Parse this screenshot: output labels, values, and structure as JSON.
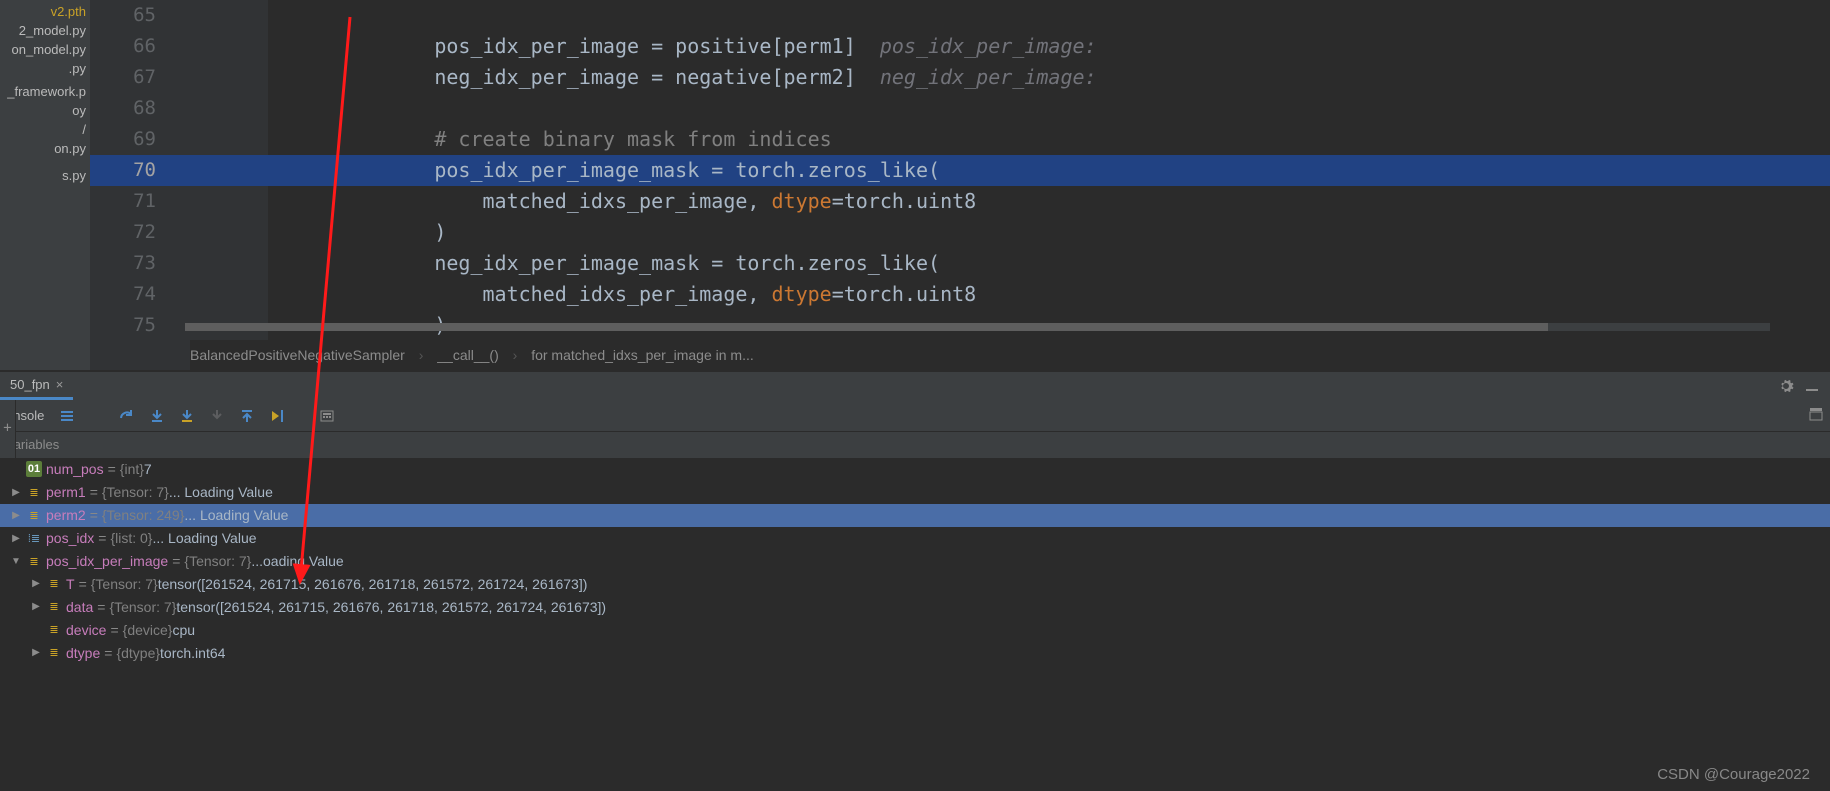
{
  "sidebar_files": [
    {
      "name": "v2.pth",
      "cls": "y"
    },
    {
      "name": "2_model.py",
      "cls": ""
    },
    {
      "name": "on_model.py",
      "cls": ""
    },
    {
      "name": ".py",
      "cls": ""
    },
    {
      "name": "",
      "cls": ""
    },
    {
      "name": "_framework.p",
      "cls": ""
    },
    {
      "name": "oy",
      "cls": ""
    },
    {
      "name": "/",
      "cls": ""
    },
    {
      "name": "on.py",
      "cls": ""
    },
    {
      "name": "",
      "cls": ""
    },
    {
      "name": "",
      "cls": ""
    },
    {
      "name": "s.py",
      "cls": ""
    }
  ],
  "code_lines": [
    {
      "n": 65,
      "sel": false,
      "text": "",
      "hint": ""
    },
    {
      "n": 66,
      "sel": false,
      "text": "        pos_idx_per_image = positive[perm1]",
      "hint": "  pos_idx_per_image:"
    },
    {
      "n": 67,
      "sel": false,
      "text": "        neg_idx_per_image = negative[perm2]",
      "hint": "  neg_idx_per_image:"
    },
    {
      "n": 68,
      "sel": false,
      "text": "",
      "hint": ""
    },
    {
      "n": 69,
      "sel": false,
      "cmt": "        # create binary mask from indices"
    },
    {
      "n": 70,
      "sel": true,
      "text": "        pos_idx_per_image_mask = torch.zeros_like("
    },
    {
      "n": 71,
      "sel": false,
      "text": "            matched_idxs_per_image, ",
      "kw": "dtype",
      "text2": "=torch.uint8"
    },
    {
      "n": 72,
      "sel": false,
      "text": "        )"
    },
    {
      "n": 73,
      "sel": false,
      "text": "        neg_idx_per_image_mask = torch.zeros_like("
    },
    {
      "n": 74,
      "sel": false,
      "text": "            matched_idxs_per_image, ",
      "kw": "dtype",
      "text2": "=torch.uint8"
    },
    {
      "n": 75,
      "sel": false,
      "text": "        )"
    }
  ],
  "breadcrumb": {
    "a": "BalancedPositiveNegativeSampler",
    "b": "__call__()",
    "c": "for matched_idxs_per_image in m..."
  },
  "tab": {
    "label": "50_fpn"
  },
  "toolbar": {
    "label": "onsole"
  },
  "varpanel": {
    "title": "Variables"
  },
  "vars": [
    {
      "lvl": 0,
      "arrow": "",
      "icon": "num01",
      "iconText": "01",
      "name": "num_pos",
      "type": "{int}",
      "val": " 7"
    },
    {
      "lvl": 0,
      "arrow": "▶",
      "icon": "tensor",
      "iconText": "≣",
      "name": "perm1",
      "type": "{Tensor: 7}",
      "val": "  ... Loading Value"
    },
    {
      "lvl": 0,
      "arrow": "▶",
      "icon": "tensor",
      "iconText": "≣",
      "name": "perm2",
      "type": "{Tensor: 249}",
      "val": "  ... Loading Value",
      "selected": true
    },
    {
      "lvl": 0,
      "arrow": "▶",
      "icon": "list",
      "iconText": "⁞≣",
      "name": "pos_idx",
      "type": "{list: 0}",
      "val": "  ... Loading Value"
    },
    {
      "lvl": 0,
      "arrow": "▼",
      "icon": "tensor",
      "iconText": "≣",
      "name": "pos_idx_per_image",
      "type": "{Tensor: 7}",
      "val": "  ...oading Value"
    },
    {
      "lvl": 1,
      "arrow": "▶",
      "icon": "tensor",
      "iconText": "≣",
      "name": "T",
      "type": "{Tensor: 7}",
      "val": " tensor([261524, 261715, 261676, 261718, 261572, 261724, 261673])"
    },
    {
      "lvl": 1,
      "arrow": "▶",
      "icon": "tensor",
      "iconText": "≣",
      "name": "data",
      "type": "{Tensor: 7}",
      "val": " tensor([261524, 261715, 261676, 261718, 261572, 261724, 261673])"
    },
    {
      "lvl": 1,
      "arrow": "",
      "icon": "tensor",
      "iconText": "≣",
      "name": "device",
      "type": "{device}",
      "val": " cpu"
    },
    {
      "lvl": 1,
      "arrow": "▶",
      "icon": "tensor",
      "iconText": "≣",
      "name": "dtype",
      "type": "{dtype}",
      "val": " torch.int64"
    }
  ],
  "watermark": "CSDN @Courage2022"
}
